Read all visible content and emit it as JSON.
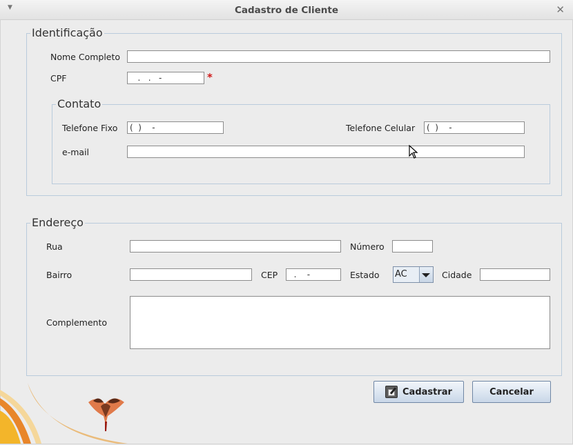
{
  "window": {
    "title": "Cadastro de Cliente"
  },
  "identificacao": {
    "legend": "Identificação",
    "nome_label": "Nome Completo",
    "nome_value": "",
    "cpf_label": "CPF",
    "cpf_value": "   .   .   -",
    "cpf_required_mark": "*"
  },
  "contato": {
    "legend": "Contato",
    "telefone_fixo_label": "Telefone Fixo",
    "telefone_fixo_value": "(  )    -",
    "telefone_celular_label": "Telefone Celular",
    "telefone_celular_value": "(  )    -",
    "email_label": "e-mail",
    "email_value": ""
  },
  "endereco": {
    "legend": "Endereço",
    "rua_label": "Rua",
    "rua_value": "",
    "numero_label": "Número",
    "numero_value": "",
    "bairro_label": "Bairro",
    "bairro_value": "",
    "cep_label": "CEP",
    "cep_value": "  .    -",
    "estado_label": "Estado",
    "estado_value": "AC",
    "cidade_label": "Cidade",
    "cidade_value": "",
    "complemento_label": "Complemento",
    "complemento_value": ""
  },
  "buttons": {
    "cadastrar": "Cadastrar",
    "cancelar": "Cancelar"
  },
  "icons": {
    "window_menu": "chevron-down-icon",
    "window_close": "close-icon",
    "required": "asterisk",
    "cadastrar": "edit-icon"
  },
  "colors": {
    "required": "#d01a1a",
    "group_border": "#b9cbdc"
  }
}
